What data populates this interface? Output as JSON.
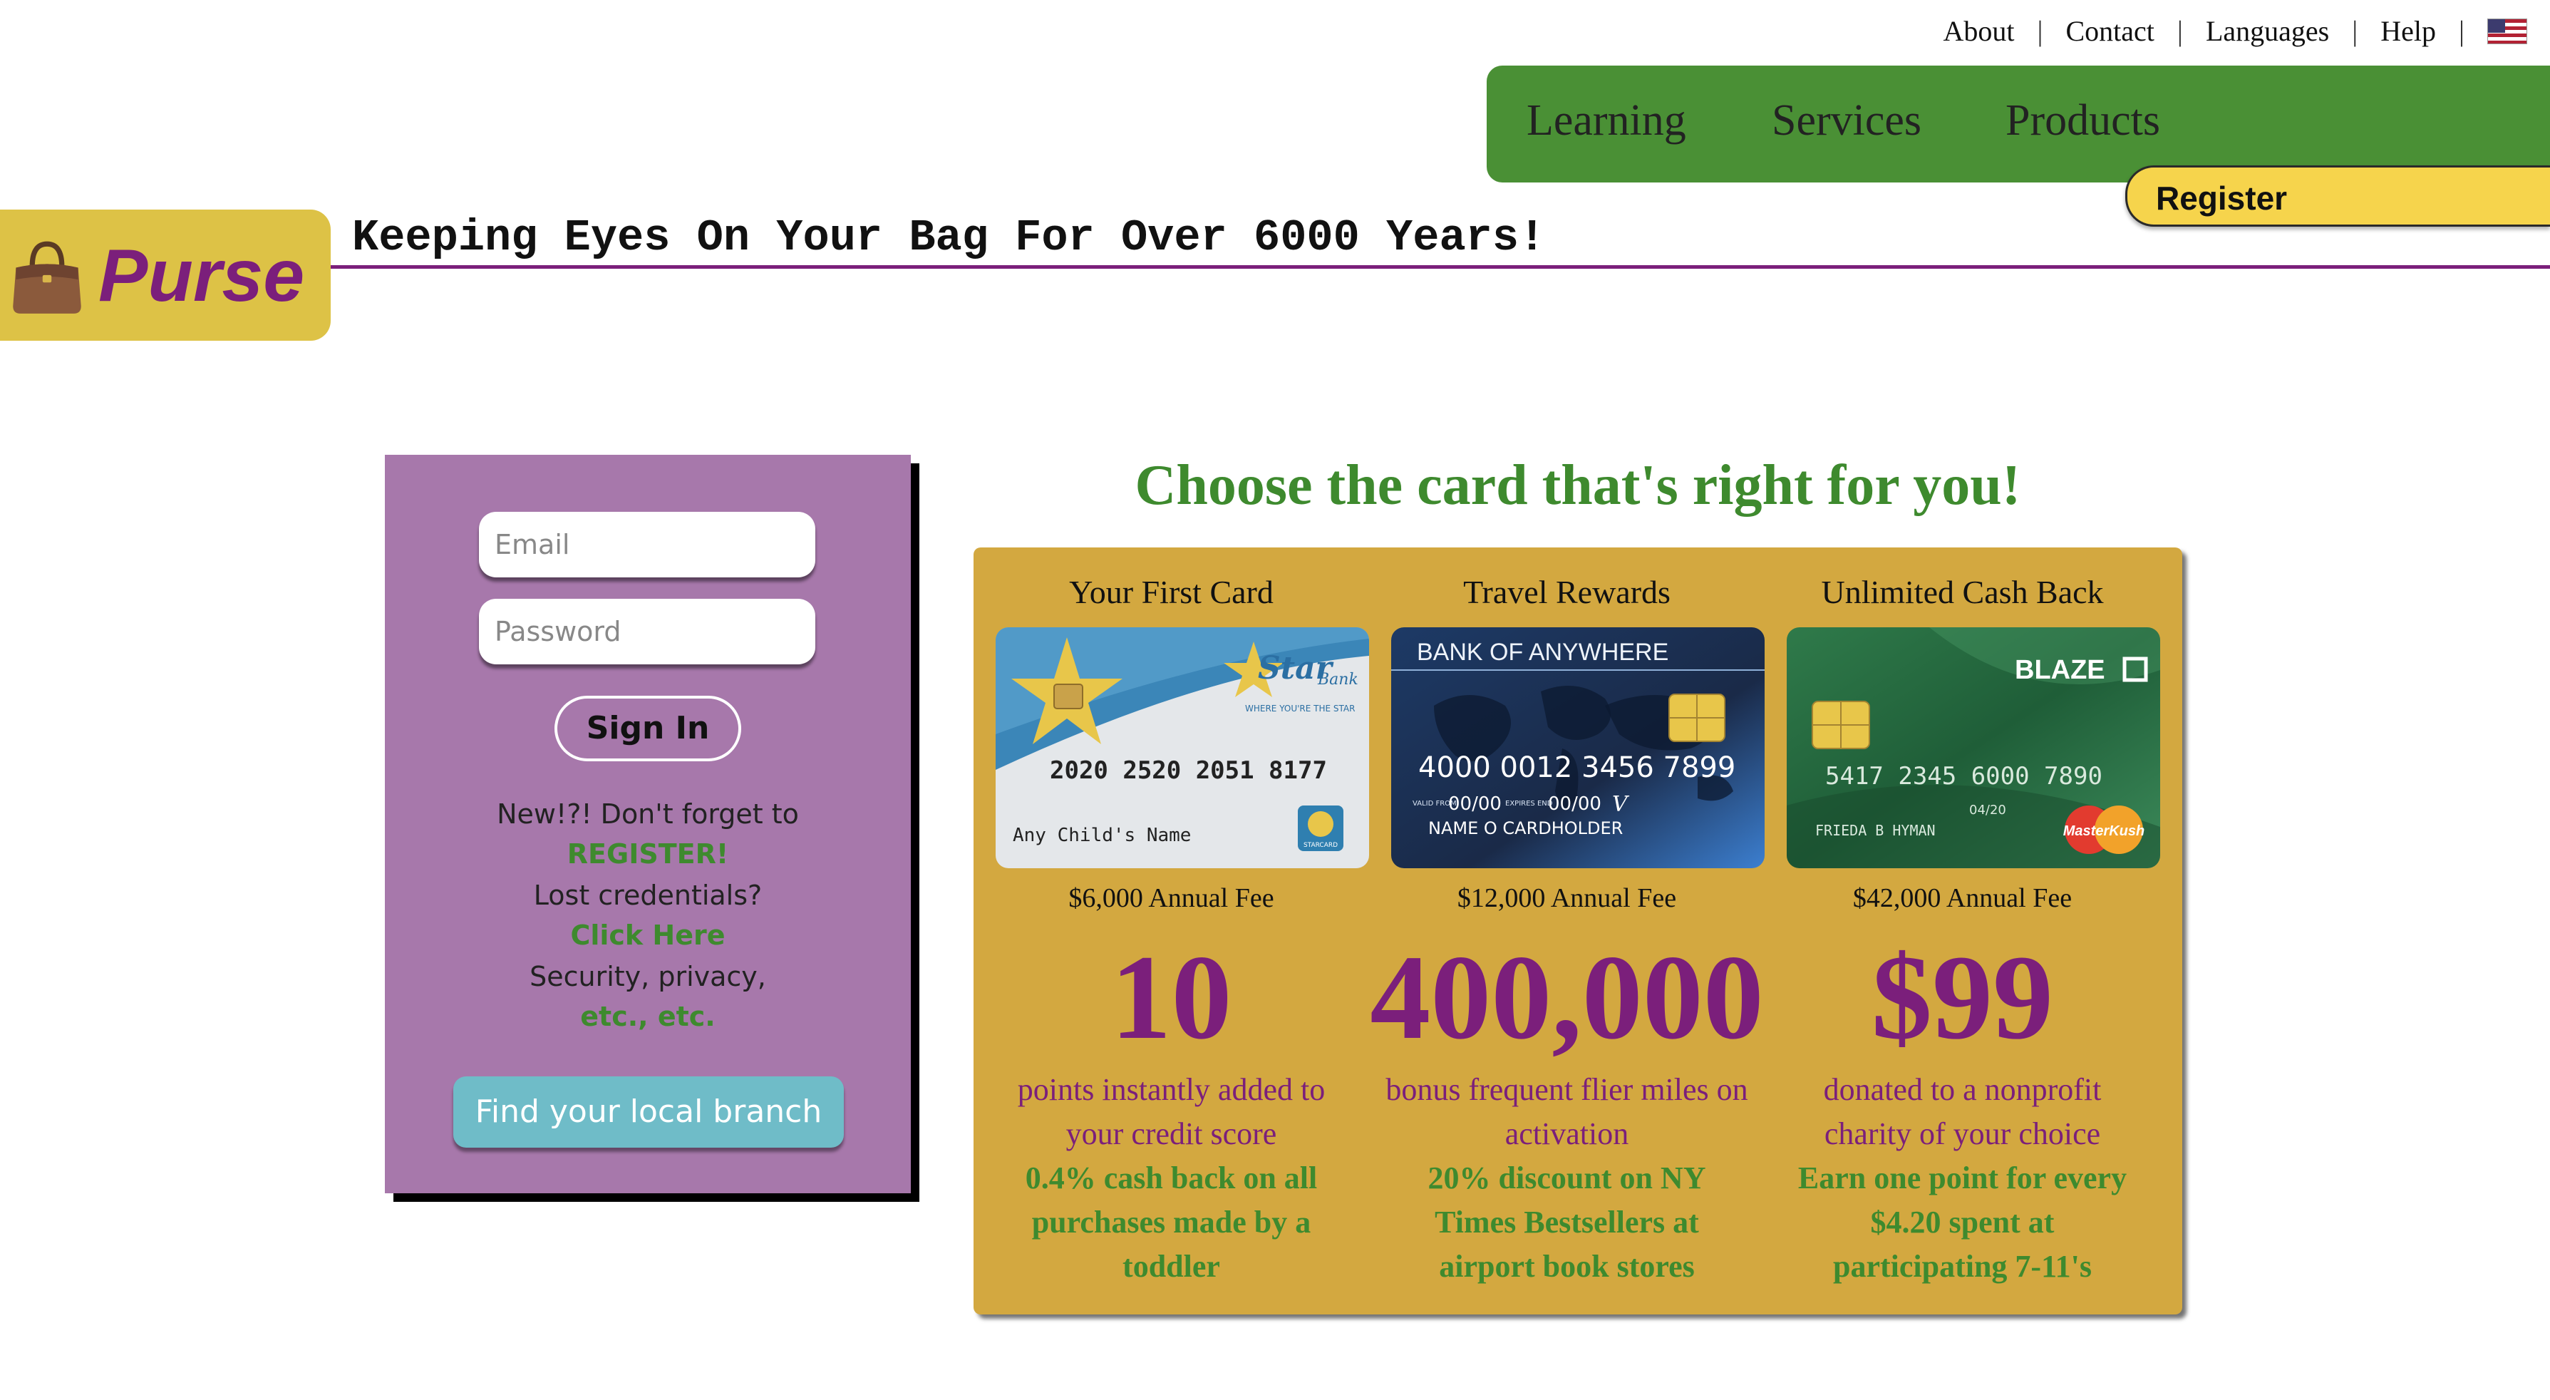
{
  "top_links": [
    "About",
    "Contact",
    "Languages",
    "Help"
  ],
  "nav": {
    "items": [
      "Learning",
      "Services",
      "Products"
    ],
    "register": "Register"
  },
  "header": {
    "logo": "Purse",
    "tagline": "Keeping Eyes On Your Bag For Over 6000 Years!"
  },
  "login": {
    "email_placeholder": "Email",
    "password_placeholder": "Password",
    "signin": "Sign In",
    "new_text": "New!?! Don't forget to",
    "register_link": "REGISTER!",
    "lost_text": "Lost credentials?",
    "click_link": "Click Here",
    "security_text": "Security, privacy,",
    "etc_link": "etc., etc.",
    "branch": "Find your local branch"
  },
  "cards": {
    "heading": "Choose the card that's right for you!",
    "items": [
      {
        "title": "Your First Card",
        "fee": "$6,000 Annual Fee",
        "big": "10",
        "perk": [
          "points instantly added to",
          "your credit score"
        ],
        "bonus": [
          "0.4% cash back on all",
          "purchases made by a",
          "toddler"
        ],
        "card_number": "2020 2520 2051 8177",
        "card_name": "Any Child's Name",
        "brand": "Star",
        "brand_sub": "Bank",
        "slogan": "WHERE YOU'RE THE STAR",
        "badge": "STARCARD"
      },
      {
        "title": "Travel Rewards",
        "fee": "$12,000 Annual Fee",
        "big": "400,000",
        "perk": [
          "bonus frequent flier miles on",
          "activation"
        ],
        "bonus": [
          "20% discount on NY",
          "Times Bestsellers at",
          "airport book stores"
        ],
        "card_number": "4000 0012 3456 7899",
        "card_name": "NAME O CARDHOLDER",
        "brand": "BANK OF ANYWHERE",
        "valid_label": "VALID FROM",
        "valid": "00/00",
        "expires_label": "EXPIRES END",
        "expires": "00/00",
        "mark": "V"
      },
      {
        "title": "Unlimited Cash Back",
        "fee": "$42,000 Annual Fee",
        "big": "$99",
        "perk": [
          "donated to a nonprofit",
          "charity of your choice"
        ],
        "bonus": [
          "Earn one point for every",
          "$4.20 spent at",
          "participating 7-11's"
        ],
        "card_number": "5417 2345 6000 7890",
        "card_name": "FRIEDA B HYMAN",
        "brand": "BLAZE",
        "expires": "04/20",
        "network": "MasterKush"
      }
    ]
  },
  "colors": {
    "nav_green": "#4a9035",
    "purple": "#7b1f7b",
    "gold": "#d3a840",
    "login_purple": "#a778ab",
    "register_yellow": "#f6d44c",
    "branch_teal": "#6fbcc8"
  }
}
